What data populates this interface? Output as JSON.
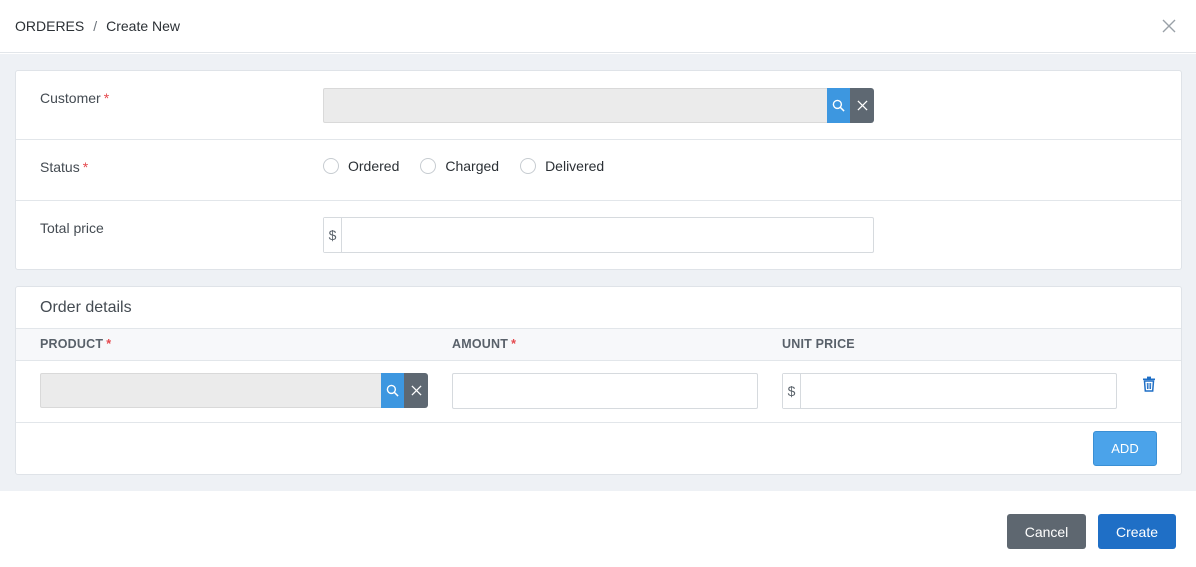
{
  "breadcrumb": {
    "parent": "ORDERES",
    "separator": "/",
    "current": "Create New"
  },
  "form": {
    "customer": {
      "label": "Customer",
      "required_mark": "*",
      "value": ""
    },
    "status": {
      "label": "Status",
      "required_mark": "*",
      "options": [
        "Ordered",
        "Charged",
        "Delivered"
      ],
      "selected": null
    },
    "total_price": {
      "label": "Total price",
      "currency_symbol": "$",
      "value": ""
    }
  },
  "details": {
    "title": "Order details",
    "columns": {
      "product": "PRODUCT",
      "amount": "AMOUNT",
      "unit_price": "UNIT PRICE",
      "required_mark": "*"
    },
    "rows": [
      {
        "product": "",
        "amount": "",
        "unit_price": "",
        "currency_symbol": "$"
      }
    ],
    "add_label": "ADD"
  },
  "footer": {
    "cancel_label": "Cancel",
    "create_label": "Create"
  },
  "colors": {
    "search_button": "#3d97e0",
    "clear_button": "#5e6872",
    "primary": "#1f6fc6",
    "secondary": "#5e6770",
    "add_button": "#4ba3ea",
    "required": "#e5484d",
    "trash_icon": "#1f6fc6"
  }
}
